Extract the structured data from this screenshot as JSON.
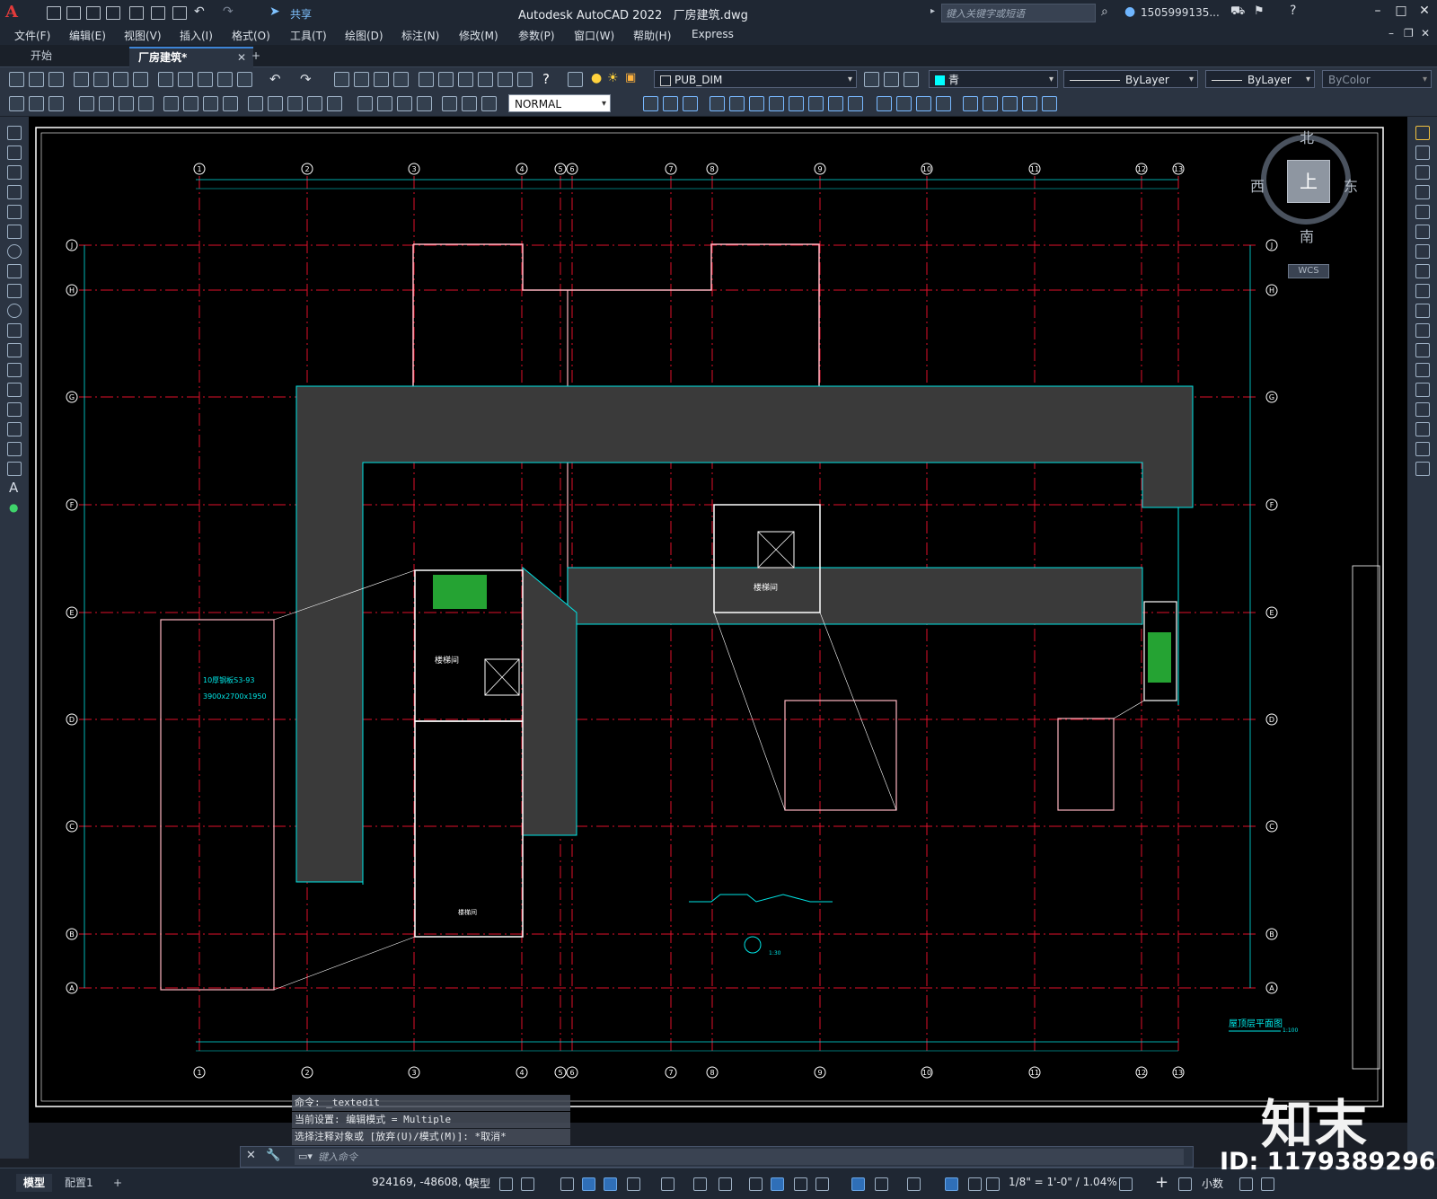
{
  "app": {
    "title": "Autodesk AutoCAD 2022",
    "filename": "厂房建筑.dwg",
    "share": "共享",
    "search_placeholder": "键入关键字或短语",
    "user": "1505999135..."
  },
  "menu": [
    "文件(F)",
    "编辑(E)",
    "视图(V)",
    "插入(I)",
    "格式(O)",
    "工具(T)",
    "绘图(D)",
    "标注(N)",
    "修改(M)",
    "参数(P)",
    "窗口(W)",
    "帮助(H)",
    "Express"
  ],
  "doc_tabs": {
    "start": "开始",
    "drawing": "厂房建筑*",
    "add": "+"
  },
  "toolbar": {
    "layer": "PUB_DIM",
    "color": "青",
    "linetype": "ByLayer",
    "lineweight": "ByLayer",
    "plotstyle": "ByColor",
    "dimstyle": "NORMAL"
  },
  "compass": {
    "north": "北",
    "south": "南",
    "east": "东",
    "west": "西",
    "top": "上",
    "wcs": "WCS"
  },
  "command": {
    "history": [
      "命令: _textedit",
      "当前设置: 编辑模式 = Multiple",
      "选择注释对象或 [放弃(U)/模式(M)]: *取消*"
    ],
    "placeholder": "键入命令"
  },
  "status": {
    "model_tab": "模型",
    "layout_tab": "配置1",
    "add": "+",
    "coords": "924169, -48608, 0",
    "space": "模型",
    "scale": "1/8\" = 1'-0\" / 1.04%",
    "units": "小数"
  },
  "drawing": {
    "col_labels": [
      "1",
      "2",
      "3",
      "4",
      "5",
      "6",
      "7",
      "8",
      "9",
      "10",
      "11",
      "12",
      "13"
    ],
    "row_labels": [
      "J",
      "H",
      "G",
      "F",
      "E",
      "D",
      "C",
      "B",
      "A"
    ],
    "stair_label_1": "楼梯间",
    "stair_label_2": "楼梯间",
    "room_label": "楼梯间",
    "plan_title": "屋顶层平面图",
    "plan_scale": "1:100",
    "note_block": "10厚钢板S3-93",
    "note_size": "3900x2700x1950",
    "detail_scale": "1:30"
  },
  "watermark": {
    "logo": "知末",
    "id": "ID: 1179389296"
  }
}
